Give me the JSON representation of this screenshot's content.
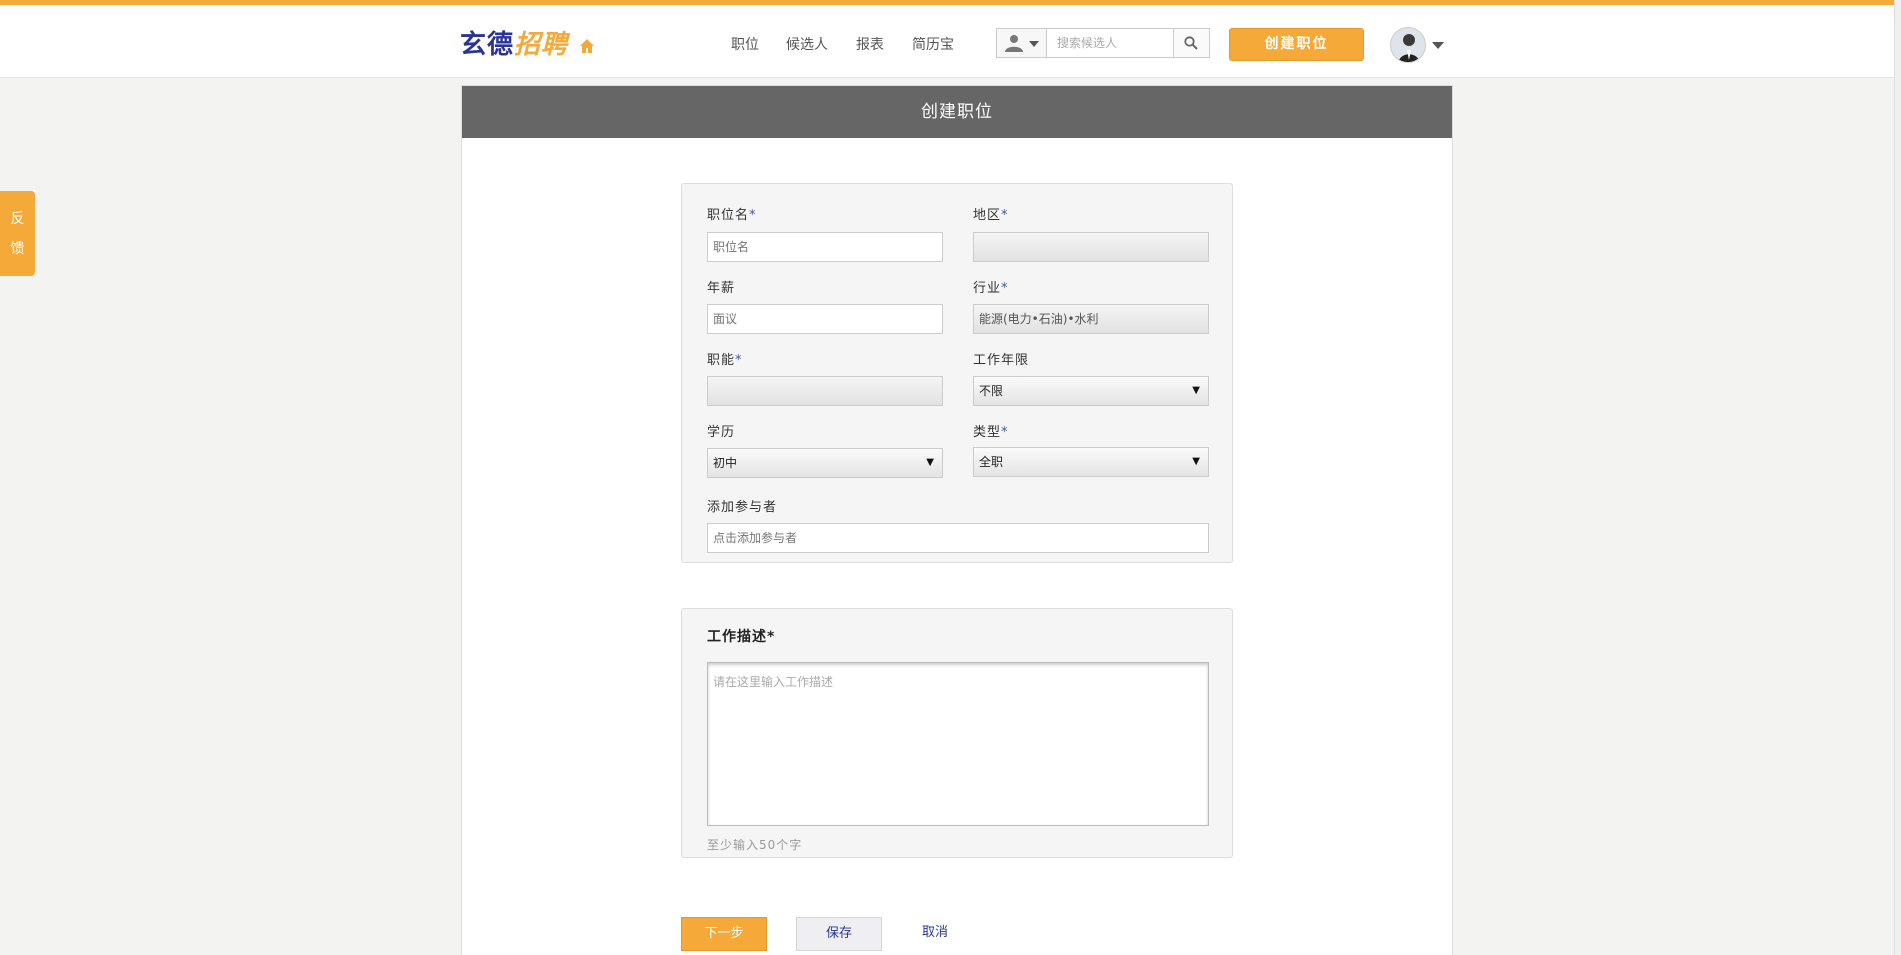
{
  "brand": {
    "name_part1": "玄德",
    "name_part2": "招聘"
  },
  "nav": {
    "items": [
      "职位",
      "候选人",
      "报表",
      "简历宝"
    ]
  },
  "search": {
    "placeholder": "搜索候选人"
  },
  "header": {
    "create_button": "创建职位"
  },
  "feedback": {
    "label_line1": "反",
    "label_line2": "馈"
  },
  "page": {
    "title": "创建职位"
  },
  "form": {
    "required_mark": "*",
    "job_title": {
      "label": "职位名",
      "placeholder": "职位名",
      "value": ""
    },
    "region": {
      "label": "地区",
      "value": ""
    },
    "salary": {
      "label": "年薪",
      "placeholder": "面议",
      "value": ""
    },
    "industry": {
      "label": "行业",
      "value": "能源(电力•石油)•水利"
    },
    "function": {
      "label": "职能",
      "value": ""
    },
    "experience": {
      "label": "工作年限",
      "value": "不限"
    },
    "education": {
      "label": "学历",
      "value": "初中"
    },
    "job_type": {
      "label": "类型",
      "value": "全职"
    },
    "participants": {
      "label": "添加参与者",
      "placeholder": "点击添加参与者"
    }
  },
  "description": {
    "label": "工作描述",
    "placeholder": "请在这里输入工作描述",
    "hint": "至少输入50个字"
  },
  "actions": {
    "next": "下一步",
    "save": "保存",
    "cancel": "取消"
  },
  "colors": {
    "accent": "#f4a939",
    "brand_blue": "#2c3493",
    "header_bar": "#666666"
  }
}
